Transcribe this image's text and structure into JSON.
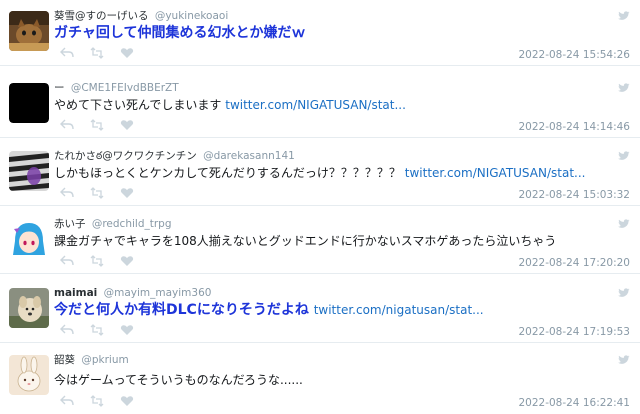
{
  "tweets": [
    {
      "name": "葵雪@すのーげいる",
      "handle": "@yukinekoaoi",
      "text": "ガチャ回して仲間集める幻水とか嫌だｗ",
      "link": "",
      "time": "2022-08-24 15:54:26",
      "avatar": "cat-photo"
    },
    {
      "name": "ー",
      "handle": "@CME1FEIvdBBErZT",
      "text": "やめて下さい死んでしまいます",
      "link": "twitter.com/NIGATUSAN/stat...",
      "time": "2022-08-24 14:14:46",
      "avatar": "black-square"
    },
    {
      "name": "たれかさఠ@ワクワクチンチン",
      "handle": "@darekasann141",
      "text": "しかもほっとくとケンカして死んだりするんだっけ？？？？？？",
      "link": "twitter.com/NIGATUSAN/stat...",
      "time": "2022-08-24 15:03:32",
      "avatar": "purple-zebra"
    },
    {
      "name": "赤い子",
      "handle": "@redchild_trpg",
      "text": "課金ガチャでキャラを108人揃えないとグッドエンドに行かないスマホゲあったら泣いちゃう",
      "link": "",
      "time": "2022-08-24 17:20:20",
      "avatar": "anime-girl-blue-hair"
    },
    {
      "name": "maimai",
      "handle": "@mayim_mayim360",
      "text": "今だと何人か有料DLCになりそうだよね",
      "link": "twitter.com/nigatusan/stat...",
      "time": "2022-08-24 17:19:53",
      "avatar": "dog-photo"
    },
    {
      "name": "韶葵",
      "handle": "@pkrium",
      "text": "今はゲームってそういうものなんだろうな......",
      "link": "",
      "time": "2022-08-24 16:22:41",
      "avatar": "bunny-drawing"
    }
  ],
  "icons": {
    "reply": "reply-icon",
    "retweet": "retweet-icon",
    "like": "heart-icon",
    "source": "twitter-bird-icon"
  },
  "colors": {
    "name": "#292f33",
    "handle": "#8899a6",
    "link": "#1b6fc4",
    "emphasis": "#1d34d9"
  }
}
